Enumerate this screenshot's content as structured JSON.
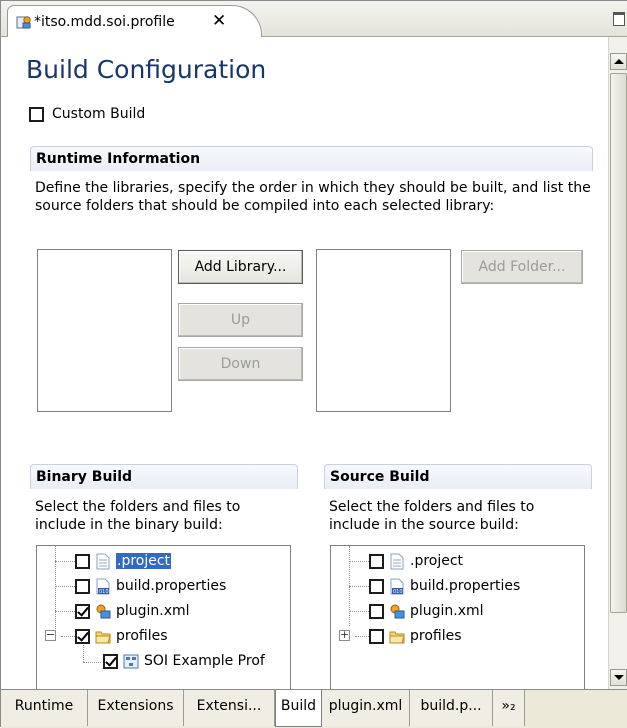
{
  "editor": {
    "tab_title": "*itso.mdd.soi.profile",
    "close_glyph": "✕"
  },
  "page": {
    "title": "Build Configuration",
    "custom_build_label": "Custom Build",
    "custom_build_checked": false
  },
  "runtime": {
    "header": "Runtime Information",
    "description": "Define the libraries, specify the order in which they should be built, and list the source folders that should be compiled into each selected library:",
    "add_library": "Add Library...",
    "up": "Up",
    "down": "Down",
    "add_folder": "Add Folder..."
  },
  "binary_build": {
    "header": "Binary Build",
    "description": "Select the folders and files to include in the binary build:",
    "items": [
      {
        "label": ".project",
        "checked": false,
        "icon": "text-file-icon",
        "selected": true
      },
      {
        "label": "build.properties",
        "checked": false,
        "icon": "properties-file-icon"
      },
      {
        "label": "plugin.xml",
        "checked": true,
        "icon": "plugin-file-icon"
      },
      {
        "label": "profiles",
        "checked": true,
        "icon": "folder-icon",
        "expander": "−"
      },
      {
        "label": "SOI Example Prof",
        "checked": true,
        "icon": "profile-file-icon"
      }
    ]
  },
  "source_build": {
    "header": "Source Build",
    "description": "Select the folders and files to include in the source build:",
    "items": [
      {
        "label": ".project",
        "checked": false,
        "icon": "text-file-icon"
      },
      {
        "label": "build.properties",
        "checked": false,
        "icon": "properties-file-icon"
      },
      {
        "label": "plugin.xml",
        "checked": false,
        "icon": "plugin-file-icon"
      },
      {
        "label": "profiles",
        "checked": false,
        "icon": "folder-icon",
        "expander": "+"
      }
    ]
  },
  "bottom_tabs": [
    {
      "label": "Runtime"
    },
    {
      "label": "Extensions"
    },
    {
      "label": "Extensi..."
    },
    {
      "label": "Build",
      "active": true
    },
    {
      "label": "plugin.xml"
    },
    {
      "label": "build.p..."
    },
    {
      "label": "»₂"
    }
  ],
  "colors": {
    "title_blue": "#17376b",
    "selection_blue": "#316ac5"
  }
}
